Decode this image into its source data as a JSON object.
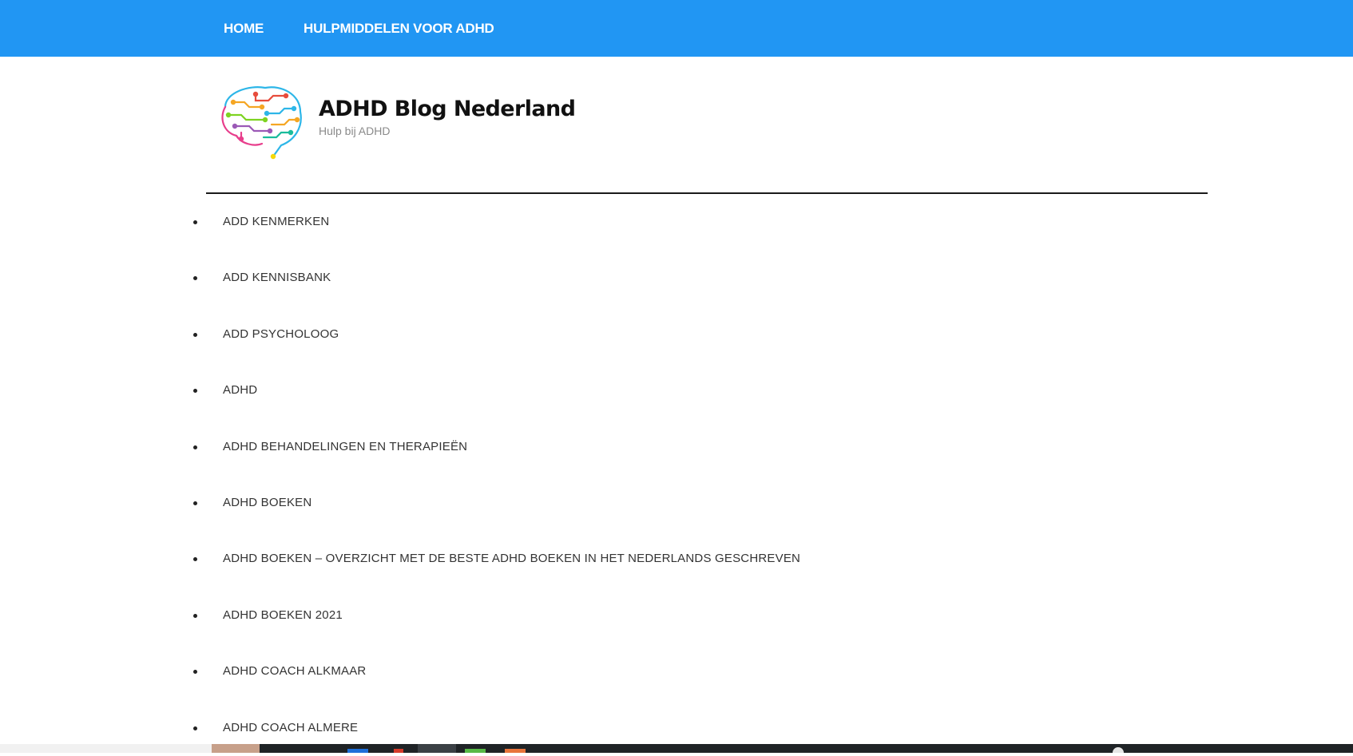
{
  "topnav": {
    "home": "HOME",
    "hulpmiddelen": "HULPMIDDELEN VOOR ADHD"
  },
  "brand": {
    "title": "ADHD Blog Nederland",
    "tagline": "Hulp bij ADHD",
    "logo_icon": "brain-circuit-icon"
  },
  "categories": [
    "ADD KENMERKEN",
    "ADD KENNISBANK",
    "ADD PSYCHOLOOG",
    "ADHD",
    "ADHD BEHANDELINGEN EN THERAPIEËN",
    "ADHD BOEKEN",
    "ADHD BOEKEN – OVERZICHT MET DE BESTE ADHD BOEKEN IN HET NEDERLANDS GESCHREVEN",
    "ADHD BOEKEN 2021",
    "ADHD COACH ALKMAAR",
    "ADHD COACH ALMERE"
  ],
  "colors": {
    "nav_background": "#2196f3",
    "nav_text": "#ffffff",
    "link_text": "#333333",
    "tagline": "#8a8a8a"
  }
}
